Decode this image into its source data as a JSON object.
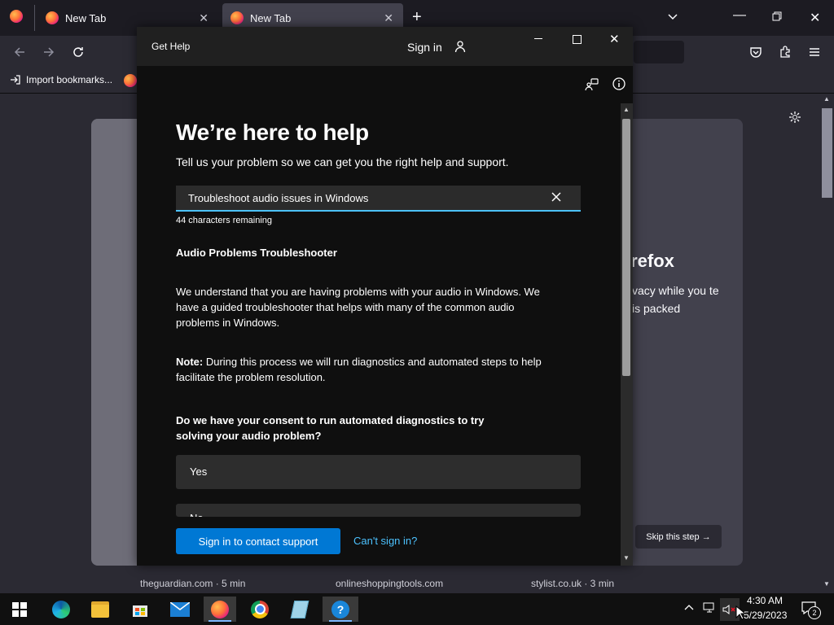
{
  "browser": {
    "tabs": [
      {
        "label": "New Tab"
      },
      {
        "label": "New Tab"
      }
    ],
    "bookmarks": {
      "import_label": "Import bookmarks..."
    },
    "background": {
      "firefox_title": "irefox",
      "firefox_text": "vacy while you te is packed",
      "skip_label": "Skip this step →",
      "shortcuts": [
        {
          "label": "theguardian.com · 5 min"
        },
        {
          "label": "onlineshoppingtools.com"
        },
        {
          "label": "stylist.co.uk · 3 min"
        }
      ]
    }
  },
  "get_help": {
    "window_title": "Get Help",
    "sign_in_label": "Sign in",
    "heading": "We’re here to help",
    "subheading": "Tell us your problem so we can get you the right help and support.",
    "search": {
      "value": "Troubleshoot audio issues in Windows",
      "chars_remaining": "44 characters remaining"
    },
    "troubleshooter_title": "Audio Problems Troubleshooter",
    "paragraph1": "We understand that you are having problems with your audio in Windows. We have a guided troubleshooter that helps with many of the common audio problems in Windows.",
    "note_label": "Note:",
    "paragraph2": " During this process we will run diagnostics and automated steps to help facilitate the problem resolution.",
    "consent_question": "Do we have your consent to run automated diagnostics to try solving your audio problem?",
    "choices": [
      {
        "label": "Yes"
      },
      {
        "label": "No"
      }
    ],
    "contact_button": "Sign in to contact support",
    "cant_sign_in": "Can't sign in?"
  },
  "taskbar": {
    "time": "4:30 AM",
    "date": "5/29/2023",
    "notification_count": "2",
    "icons": [
      "windows-start-icon",
      "edge-icon",
      "file-explorer-icon",
      "store-icon",
      "mail-icon",
      "firefox-icon",
      "chrome-icon",
      "notepad-icon",
      "get-help-icon"
    ]
  },
  "colors": {
    "accent": "#0078d4",
    "link": "#4cc2ff",
    "window_bg": "#0f0f0f",
    "browser_bg": "#2b2a33"
  }
}
